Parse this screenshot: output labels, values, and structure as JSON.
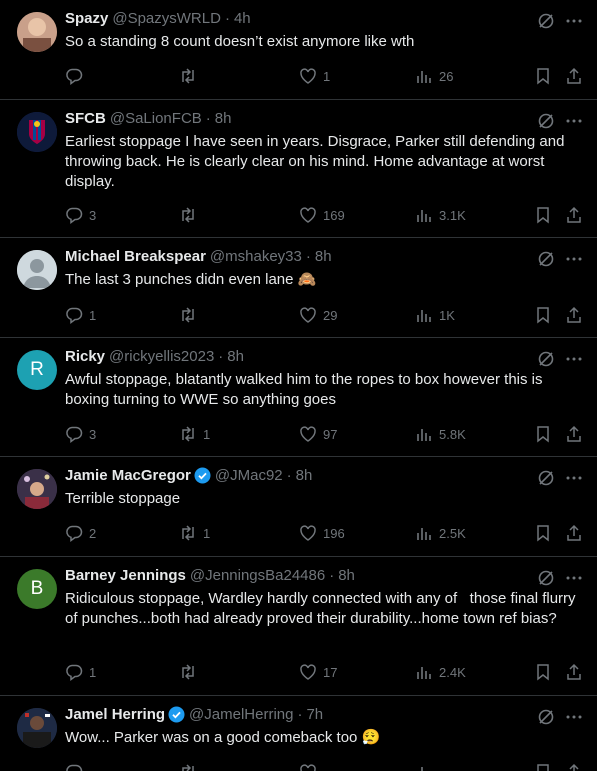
{
  "tweets": [
    {
      "name": "Spazy",
      "handle": "@SpazysWRLD",
      "time": "4h",
      "text": "So a standing 8 count doesn’t exist anymore like wth",
      "replies": "",
      "retweets": "",
      "likes": "1",
      "views": "26",
      "verified": false,
      "avatar_color": "#8a6a5a",
      "avatar_letter": ""
    },
    {
      "name": "SFCB",
      "handle": "@SaLionFCB",
      "time": "8h",
      "text": "Earliest stoppage I have seen in years. Disgrace, Parker still defending and throwing back. He is clearly clear on his mind. Home advantage at worst display.",
      "replies": "3",
      "retweets": "",
      "likes": "169",
      "views": "3.1K",
      "verified": false,
      "avatar_color": "#1b2a5e",
      "avatar_letter": ""
    },
    {
      "name": "Michael Breakspear",
      "handle": "@mshakey33",
      "time": "8h",
      "text": "The last 3 punches didn even lane 🙈",
      "replies": "1",
      "retweets": "",
      "likes": "29",
      "views": "1K",
      "verified": false,
      "avatar_color": "#cfd9de",
      "avatar_letter": ""
    },
    {
      "name": "Ricky",
      "handle": "@rickyellis2023",
      "time": "8h",
      "text": "Awful stoppage, blatantly walked him to the ropes to box however this is boxing turning to WWE so anything goes",
      "replies": "3",
      "retweets": "1",
      "likes": "97",
      "views": "5.8K",
      "verified": false,
      "avatar_color": "#1da1b2",
      "avatar_letter": "R"
    },
    {
      "name": "Jamie MacGregor",
      "handle": "@JMac92",
      "time": "8h",
      "text": "Terrible stoppage",
      "replies": "2",
      "retweets": "1",
      "likes": "196",
      "views": "2.5K",
      "verified": true,
      "avatar_color": "#5b4b6e",
      "avatar_letter": ""
    },
    {
      "name": "Barney Jennings",
      "handle": "@JenningsBa24486",
      "time": "8h",
      "text": "Ridiculous stoppage, Wardley hardly connected with any of   those final flurry of punches...both had already proved their durability...home town ref bias?",
      "replies": "1",
      "retweets": "",
      "likes": "17",
      "views": "2.4K",
      "verified": false,
      "avatar_color": "#3b7a2a",
      "avatar_letter": "B"
    },
    {
      "name": "Jamel Herring",
      "handle": "@JamelHerring",
      "time": "7h",
      "text": "Wow... Parker was on a good comeback too 😮‍💨",
      "replies": "",
      "retweets": "",
      "likes": "",
      "views": "",
      "verified": true,
      "avatar_color": "#2a3a5a",
      "avatar_letter": ""
    }
  ],
  "colors": {
    "background": "#000000",
    "text": "#e7e9ea",
    "muted": "#71767b",
    "divider": "#2f3336",
    "verified": "#1d9bf0"
  },
  "icons": [
    "grok-icon",
    "more-icon",
    "reply-icon",
    "retweet-icon",
    "like-icon",
    "views-icon",
    "bookmark-icon",
    "share-icon",
    "verified-icon"
  ]
}
